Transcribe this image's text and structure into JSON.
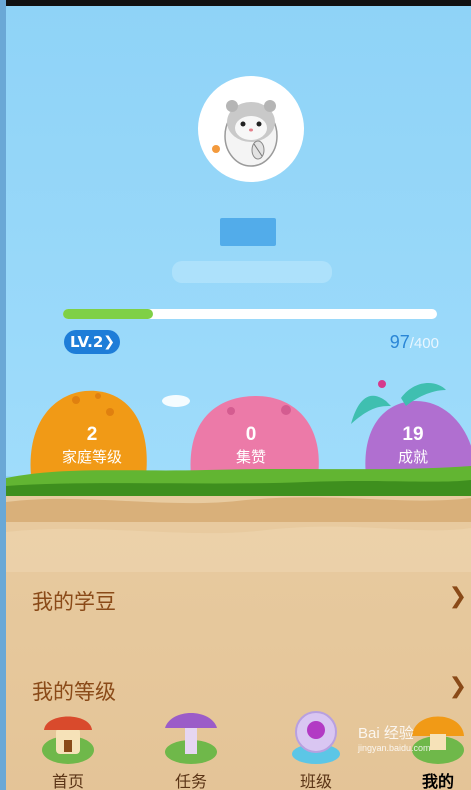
{
  "profile": {
    "level_label": "LV.2",
    "exp_current": "97",
    "exp_max": "/400",
    "progress_fraction": 0.24
  },
  "stats": [
    {
      "value": "2",
      "label": "家庭等级"
    },
    {
      "value": "0",
      "label": "集赞"
    },
    {
      "value": "19",
      "label": "成就"
    }
  ],
  "menu": [
    {
      "label": "我的学豆"
    },
    {
      "label": "我的等级"
    }
  ],
  "tabs": [
    {
      "label": "首页"
    },
    {
      "label": "任务"
    },
    {
      "label": "班级"
    },
    {
      "label": "我的"
    }
  ],
  "watermark": {
    "text": "Bai 经验",
    "sub": "jingyan.baidu.com"
  },
  "colors": {
    "sky": "#8fd3f7",
    "accent_blue": "#1e7dd8",
    "progress_green": "#7fd046",
    "menu_text": "#8a4a18"
  },
  "icons": {
    "avatar": "hamster-avatar",
    "level_chevron": "chevron-right-icon",
    "menu_chevron": "chevron-right-icon",
    "tab_home": "mushroom-house-icon",
    "tab_task": "purple-mushroom-icon",
    "tab_class": "crystal-ball-icon",
    "tab_mine": "orange-mushroom-icon"
  }
}
